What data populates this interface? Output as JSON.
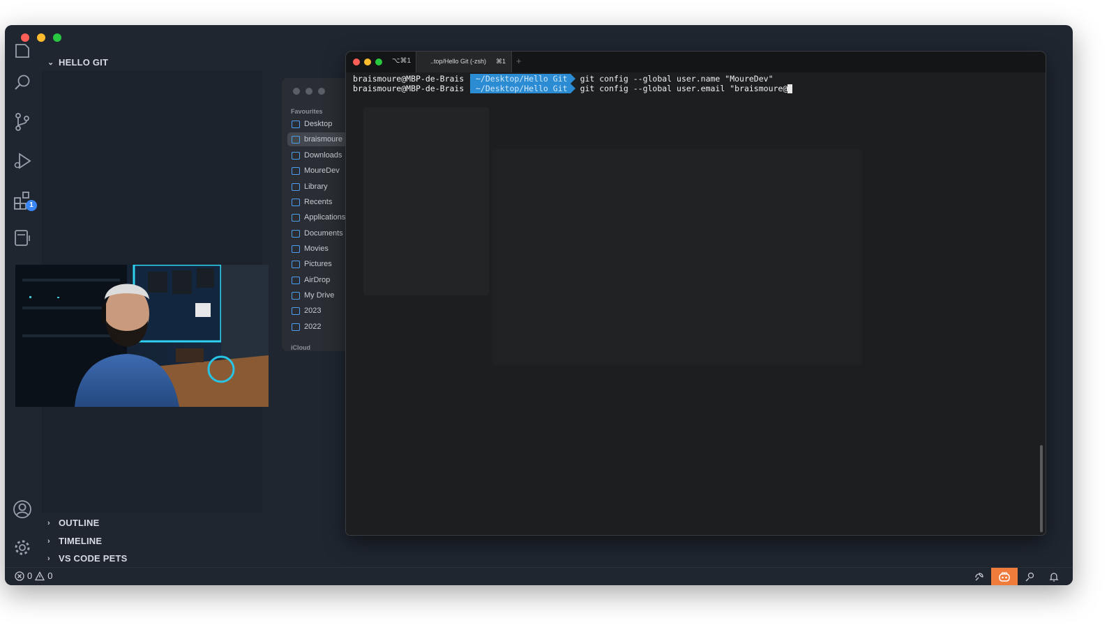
{
  "explorer": {
    "project_title": "HELLO GIT",
    "collapsed_sections": [
      "OUTLINE",
      "TIMELINE",
      "VS CODE PETS"
    ]
  },
  "activitybar": {
    "extensions_badge": "1"
  },
  "finder": {
    "favourites_header": "Favourites",
    "items": [
      "Desktop",
      "braismoure",
      "Downloads",
      "MoureDev",
      "Library",
      "Recents",
      "Applications",
      "Documents",
      "Movies",
      "Pictures",
      "AirDrop",
      "My Drive",
      "2023",
      "2022"
    ],
    "selected_item": "braismoure",
    "icloud_header": "iCloud"
  },
  "terminal": {
    "shortcut_left": "⌥⌘1",
    "tab_title": "..top/Hello Git (-zsh)",
    "tab_shortcut": "⌘1",
    "new_tab": "+",
    "lines": [
      {
        "user": "braismoure@MBP-de-Brais",
        "path": "~/Desktop/Hello Git",
        "command": "git config --global user.name \"MoureDev\""
      },
      {
        "user": "braismoure@MBP-de-Brais",
        "path": "~/Desktop/Hello Git",
        "command": "git config --global user.email \"braismoure@"
      }
    ]
  },
  "statusbar": {
    "errors": "0",
    "warnings": "0"
  },
  "colors": {
    "window_bg": "#1f2630",
    "terminal_bg": "#1d1e20",
    "prompt_path_bg": "#2b8bd3",
    "status_accent": "#f07c3c",
    "badge": "#3b86f7"
  }
}
